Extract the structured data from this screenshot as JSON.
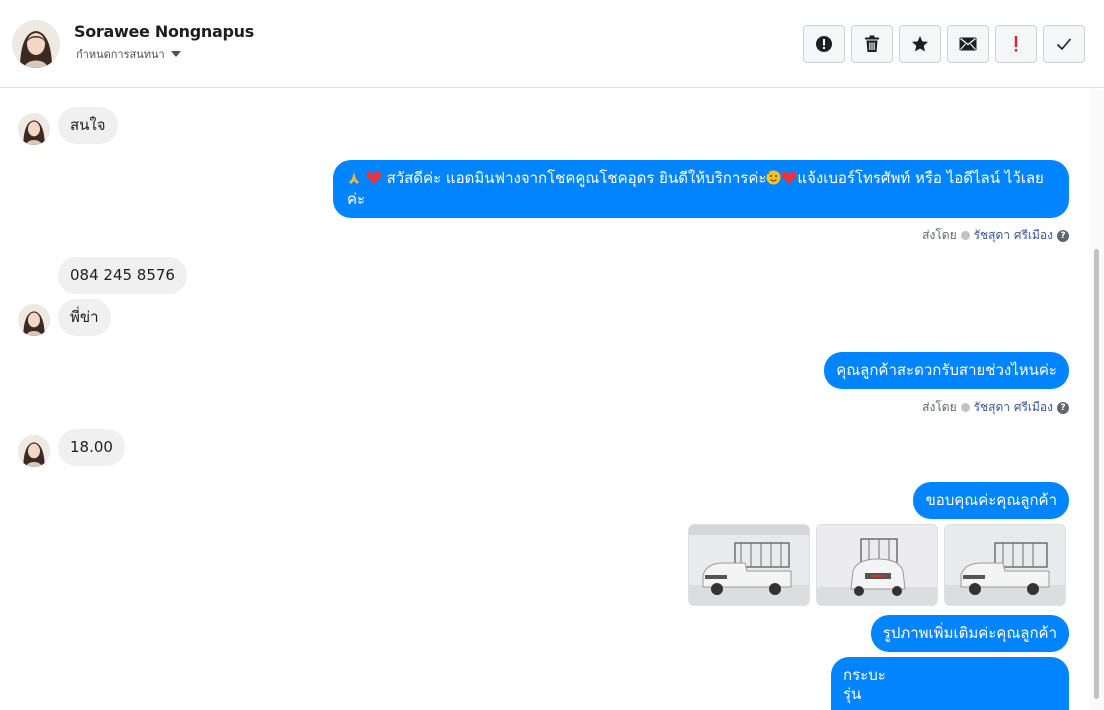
{
  "header": {
    "contact_name": "Sorawee Nongnapus",
    "assign_label": "กำหนดการสนทนา",
    "actions": [
      {
        "icon": "alert-circle-icon",
        "label": "Mark as spam"
      },
      {
        "icon": "trash-icon",
        "label": "Delete"
      },
      {
        "icon": "star-icon",
        "label": "Star"
      },
      {
        "icon": "envelope-icon",
        "label": "Mark as unread"
      },
      {
        "icon": "exclamation-icon",
        "label": "Follow up"
      },
      {
        "icon": "check-icon",
        "label": "Mark as done"
      }
    ]
  },
  "messages": {
    "m1": "สนใจ",
    "m2": "สวัสดีค่ะ แอดมินฟางจากโชคคูณโชคอุดร ยินดีให้บริการค่ะ",
    "m2_tail": "แจ้งเบอร์โทรศัพท์ หรือ ไอดีไลน์  ไว้เลยค่ะ",
    "m3": "084 245 8576",
    "m4": "พี่ข่า",
    "m5": "คุณลูกค้าสะดวกรับสายช่วงไหนค่ะ",
    "m6": "18.00",
    "m7": "ขอบคุณค่ะคุณลูกค้า",
    "m8": "รูปภาพเพิ่มเติมค่ะคุณลูกค้า",
    "m9_line1": "กระบะ",
    "m9_line2": "รุ่น"
  },
  "sent_by": {
    "prefix": "ส่งโดย",
    "agent": "รัชสุดา ศรีเมือง"
  },
  "colors": {
    "outgoing": "#0084ff",
    "incoming": "#f1f0f0",
    "danger": "#e02020"
  }
}
